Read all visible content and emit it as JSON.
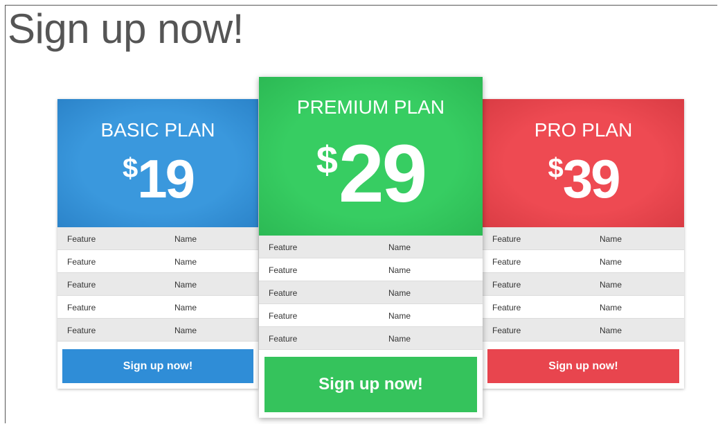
{
  "page": {
    "title": "Sign up now!"
  },
  "plans": [
    {
      "name": "BASIC PLAN",
      "currency": "$",
      "price": "19",
      "color": "#3a98dd",
      "rows": [
        {
          "feature": "Feature",
          "name": "Name"
        },
        {
          "feature": "Feature",
          "name": "Name"
        },
        {
          "feature": "Feature",
          "name": "Name"
        },
        {
          "feature": "Feature",
          "name": "Name"
        },
        {
          "feature": "Feature",
          "name": "Name"
        }
      ],
      "button": "Sign up now!"
    },
    {
      "name": "PREMIUM PLAN",
      "currency": "$",
      "price": "29",
      "color": "#37cd62",
      "rows": [
        {
          "feature": "Feature",
          "name": "Name"
        },
        {
          "feature": "Feature",
          "name": "Name"
        },
        {
          "feature": "Feature",
          "name": "Name"
        },
        {
          "feature": "Feature",
          "name": "Name"
        },
        {
          "feature": "Feature",
          "name": "Name"
        }
      ],
      "button": "Sign up now!"
    },
    {
      "name": "PRO PLAN",
      "currency": "$",
      "price": "39",
      "color": "#ee4a52",
      "rows": [
        {
          "feature": "Feature",
          "name": "Name"
        },
        {
          "feature": "Feature",
          "name": "Name"
        },
        {
          "feature": "Feature",
          "name": "Name"
        },
        {
          "feature": "Feature",
          "name": "Name"
        },
        {
          "feature": "Feature",
          "name": "Name"
        }
      ],
      "button": "Sign up now!"
    }
  ]
}
